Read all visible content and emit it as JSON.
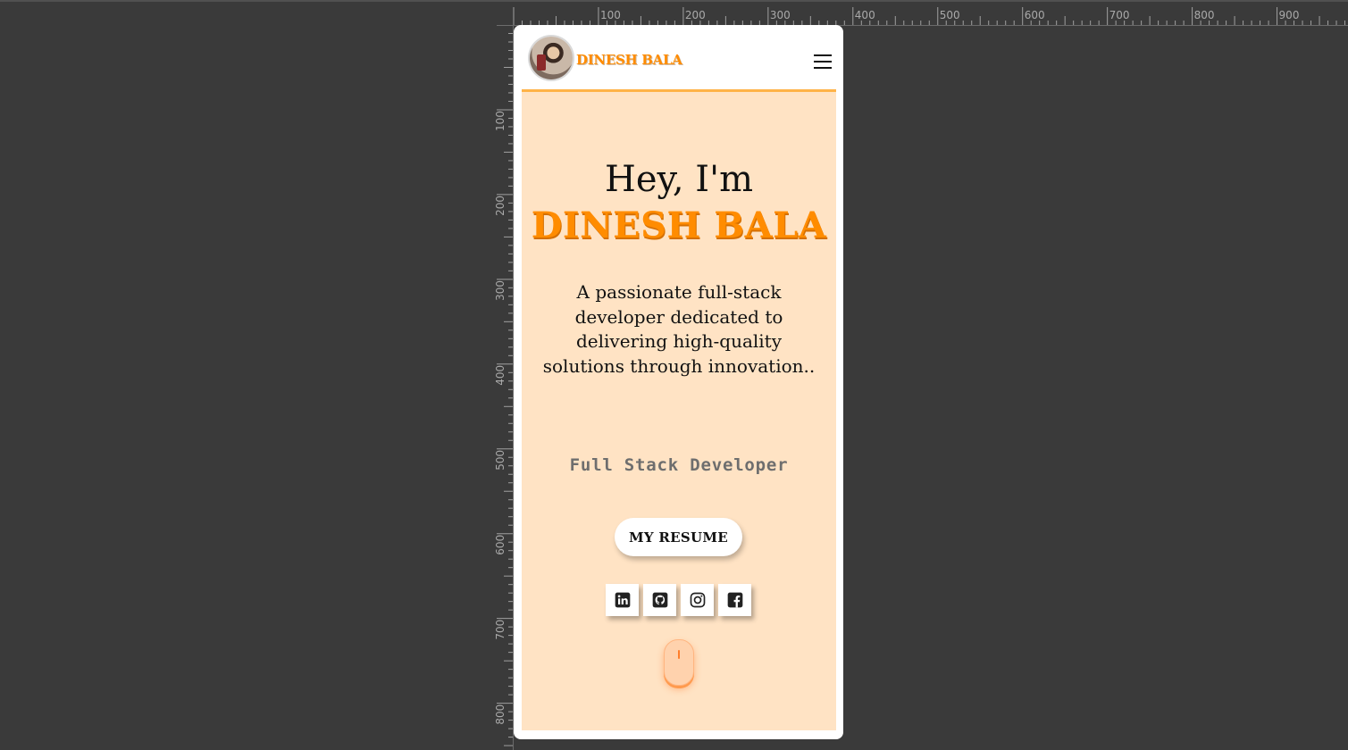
{
  "ruler": {
    "h_labels": [
      "100",
      "200",
      "300",
      "400",
      "500",
      "600",
      "700",
      "800",
      "900"
    ],
    "v_labels": [
      "100",
      "200",
      "300",
      "400",
      "500",
      "600",
      "700",
      "800"
    ]
  },
  "navbar": {
    "brand": "DINESH BALA",
    "avatar_alt": "profile photo",
    "menu_icon": "hamburger-menu-icon"
  },
  "hero": {
    "greeting": "Hey, I'm",
    "name": "DINESH BALA",
    "tagline": "A passionate full-stack developer dedicated to delivering high-quality solutions through innovation..",
    "role": "Full Stack Developer",
    "resume_button": "MY RESUME",
    "socials": [
      {
        "name": "linkedin-icon"
      },
      {
        "name": "github-icon"
      },
      {
        "name": "instagram-icon"
      },
      {
        "name": "facebook-icon"
      }
    ],
    "scroll_indicator": "mouse-scroll-icon"
  },
  "colors": {
    "accent": "#ff8c00",
    "hero_bg": "#ffe3c4",
    "nav_border": "#ffb347",
    "editor_bg": "#3a3a3a"
  }
}
